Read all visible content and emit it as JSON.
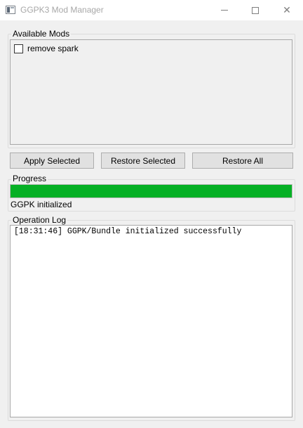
{
  "window": {
    "title": "GGPK3 Mod Manager",
    "app_icon": "window-app-icon",
    "controls": {
      "minimize_icon": "minimize-icon",
      "maximize_icon": "maximize-icon",
      "close_icon": "close-icon",
      "close_glyph": "✕"
    }
  },
  "available_mods": {
    "label": "Available Mods",
    "items": [
      {
        "label": "remove spark",
        "checked": false
      }
    ]
  },
  "buttons": {
    "apply": "Apply Selected",
    "restore_selected": "Restore Selected",
    "restore_all": "Restore All"
  },
  "progress": {
    "label": "Progress",
    "value_percent": 100,
    "status": "GGPK initialized",
    "fill_color": "#06b025"
  },
  "log": {
    "label": "Operation Log",
    "lines": [
      "[18:31:46] GGPK/Bundle initialized successfully"
    ]
  }
}
